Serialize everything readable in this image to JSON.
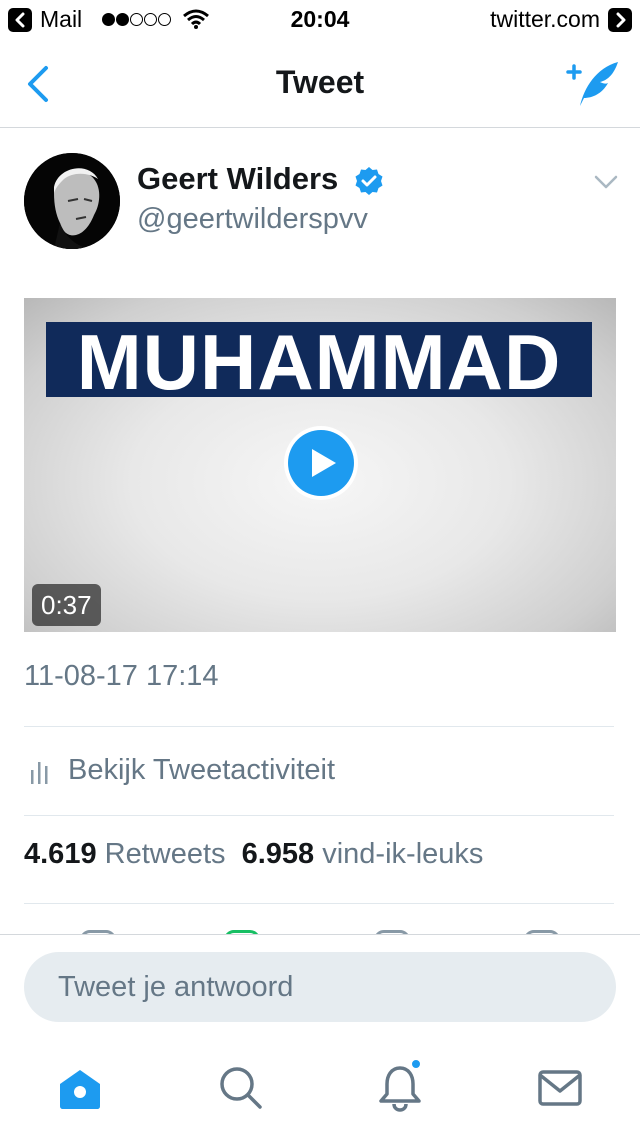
{
  "status_bar": {
    "back_app": "Mail",
    "time": "20:04",
    "site": "twitter.com"
  },
  "nav": {
    "title": "Tweet",
    "back_icon": "chevron-left-icon",
    "compose_icon": "compose-tweet-icon",
    "accent_color": "#1d9bf0"
  },
  "tweet": {
    "author_name": "Geert Wilders",
    "author_handle": "@geertwilderspvv",
    "verified": true,
    "media": {
      "title_text": "MUHAMMAD",
      "duration": "0:37"
    },
    "timestamp": "11-08-17 17:14",
    "activity_label": "Bekijk Tweetactiviteit",
    "stats": {
      "retweets_count": "4.619",
      "retweets_label": "Retweets",
      "likes_count": "6.958",
      "likes_label": "vind-ik-leuks"
    }
  },
  "reply": {
    "placeholder": "Tweet je antwoord"
  },
  "tabs": [
    {
      "name": "home",
      "icon": "home-icon",
      "active": true
    },
    {
      "name": "search",
      "icon": "search-icon",
      "active": false
    },
    {
      "name": "notifications",
      "icon": "bell-icon",
      "active": false,
      "badge": true
    },
    {
      "name": "messages",
      "icon": "envelope-icon",
      "active": false
    }
  ]
}
